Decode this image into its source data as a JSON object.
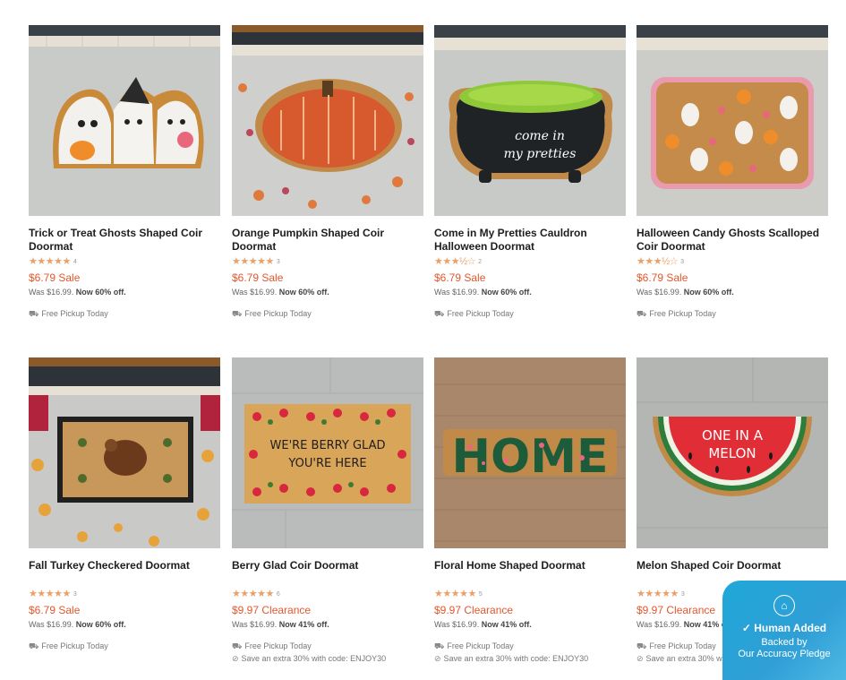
{
  "products": [
    {
      "title": "Trick or Treat Ghosts Shaped Coir Doormat",
      "stars": "★★★★★",
      "count": "4",
      "price": "$6.79 Sale",
      "was": "Was $16.99.",
      "now": "Now 60% off.",
      "pickup": "Free Pickup Today",
      "promo": ""
    },
    {
      "title": "Orange Pumpkin Shaped Coir Doormat",
      "stars": "★★★★★",
      "count": "3",
      "price": "$6.79 Sale",
      "was": "Was $16.99.",
      "now": "Now 60% off.",
      "pickup": "Free Pickup Today",
      "promo": ""
    },
    {
      "title": "Come in My Pretties Cauldron Halloween Doormat",
      "stars": "★★★½☆",
      "count": "2",
      "price": "$6.79 Sale",
      "was": "Was $16.99.",
      "now": "Now 60% off.",
      "pickup": "Free Pickup Today",
      "promo": ""
    },
    {
      "title": "Halloween Candy Ghosts Scalloped Coir Doormat",
      "stars": "★★★½☆",
      "count": "3",
      "price": "$6.79 Sale",
      "was": "Was $16.99.",
      "now": "Now 60% off.",
      "pickup": "Free Pickup Today",
      "promo": ""
    },
    {
      "title": "Fall Turkey Checkered Doormat",
      "stars": "★★★★★",
      "count": "3",
      "price": "$6.79 Sale",
      "was": "Was $16.99.",
      "now": "Now 60% off.",
      "pickup": "Free Pickup Today",
      "promo": ""
    },
    {
      "title": "Berry Glad Coir Doormat",
      "stars": "★★★★★",
      "count": "6",
      "price": "$9.97 Clearance",
      "was": "Was $16.99.",
      "now": "Now 41% off.",
      "pickup": "Free Pickup Today",
      "promo": "Save an extra 30% with code: ENJOY30"
    },
    {
      "title": "Floral Home Shaped Doormat",
      "stars": "★★★★★",
      "count": "5",
      "price": "$9.97 Clearance",
      "was": "Was $16.99.",
      "now": "Now 41% off.",
      "pickup": "Free Pickup Today",
      "promo": "Save an extra 30% with code: ENJOY30"
    },
    {
      "title": "Melon Shaped Coir Doormat",
      "stars": "★★★★★",
      "count": "3",
      "price": "$9.97 Clearance",
      "was": "Was $16.99.",
      "now": "Now 41% off.",
      "pickup": "Free Pickup Today",
      "promo": "Save an extra 30% with code: ENJOY30"
    }
  ],
  "mat_text": {
    "cauldron": [
      "come in",
      "my pretties"
    ],
    "berry": [
      "WE'RE BERRY GLAD",
      "YOU'RE HERE"
    ],
    "home": "HOME",
    "melon": [
      "ONE IN A",
      "MELON"
    ]
  },
  "badge": {
    "title": "Human Added",
    "line1": "Backed by",
    "line2": "Our Accuracy Pledge"
  },
  "colors": {
    "price": "#e2572e",
    "stars": "#e9a06a",
    "badge": "#2f9fd6"
  }
}
